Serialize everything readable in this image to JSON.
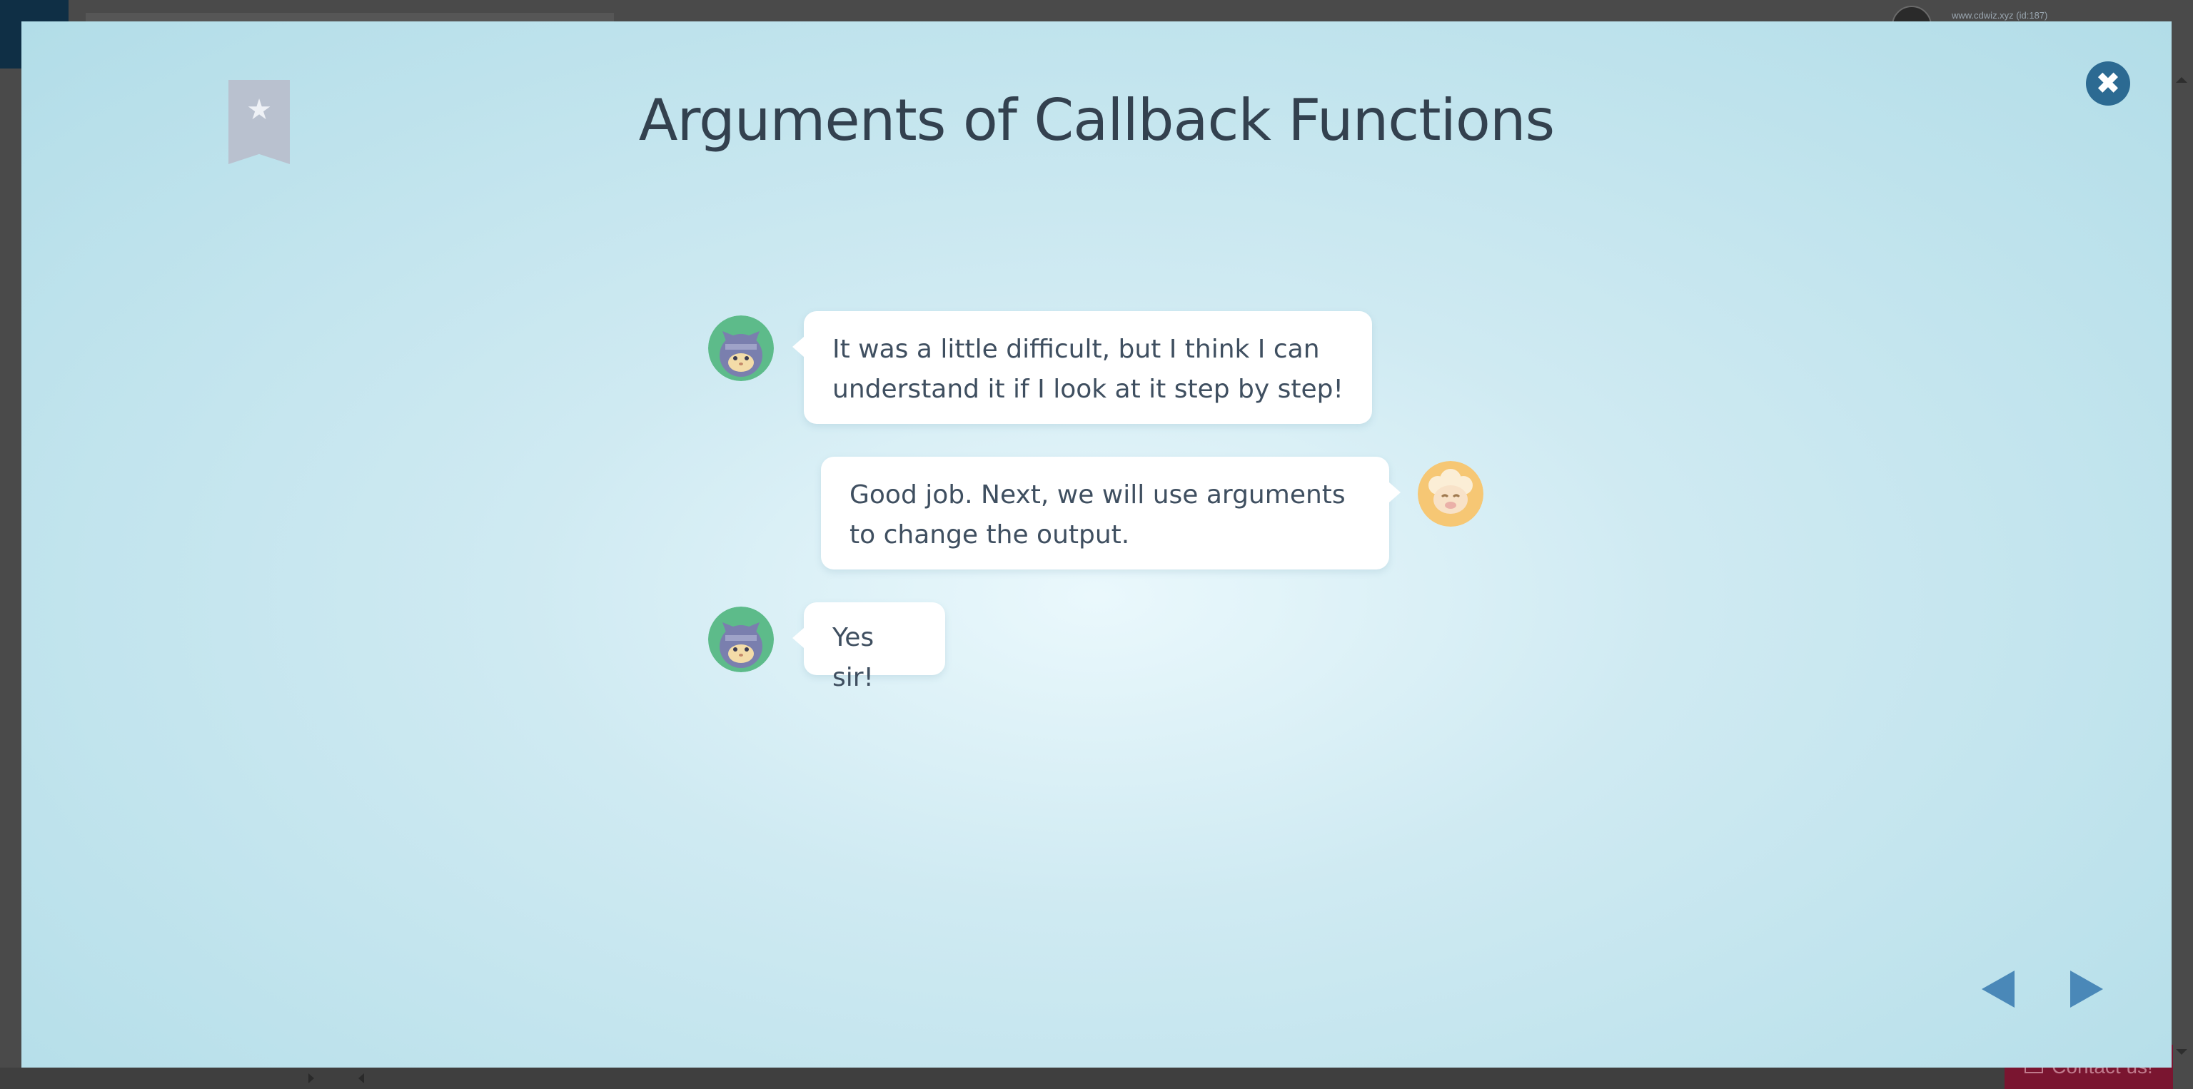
{
  "background_app": {
    "user_label": "www.cdwiz.xyz (id:187)",
    "contact_label": "Contact us!"
  },
  "lesson": {
    "title": "Arguments of Callback Functions",
    "bookmark_icon": "star-icon",
    "close_icon": "close-icon"
  },
  "chat": [
    {
      "speaker": "ninja-cat",
      "side": "left",
      "text": "It was a little difficult, but I think I can understand it if I look at it step by step!"
    },
    {
      "speaker": "sheep",
      "side": "right",
      "text": "Good job. Next, we will use arguments to change the output."
    },
    {
      "speaker": "ninja-cat",
      "side": "left",
      "text": "Yes sir!"
    }
  ],
  "navigation": {
    "prev_icon": "triangle-left-icon",
    "next_icon": "triangle-right-icon"
  },
  "colors": {
    "accent": "#2c6a92",
    "nav_arrow": "#4a88b8",
    "title_text": "#33414f",
    "bubble_text": "#3f4f60",
    "bookmark": "#b9c1cf"
  }
}
